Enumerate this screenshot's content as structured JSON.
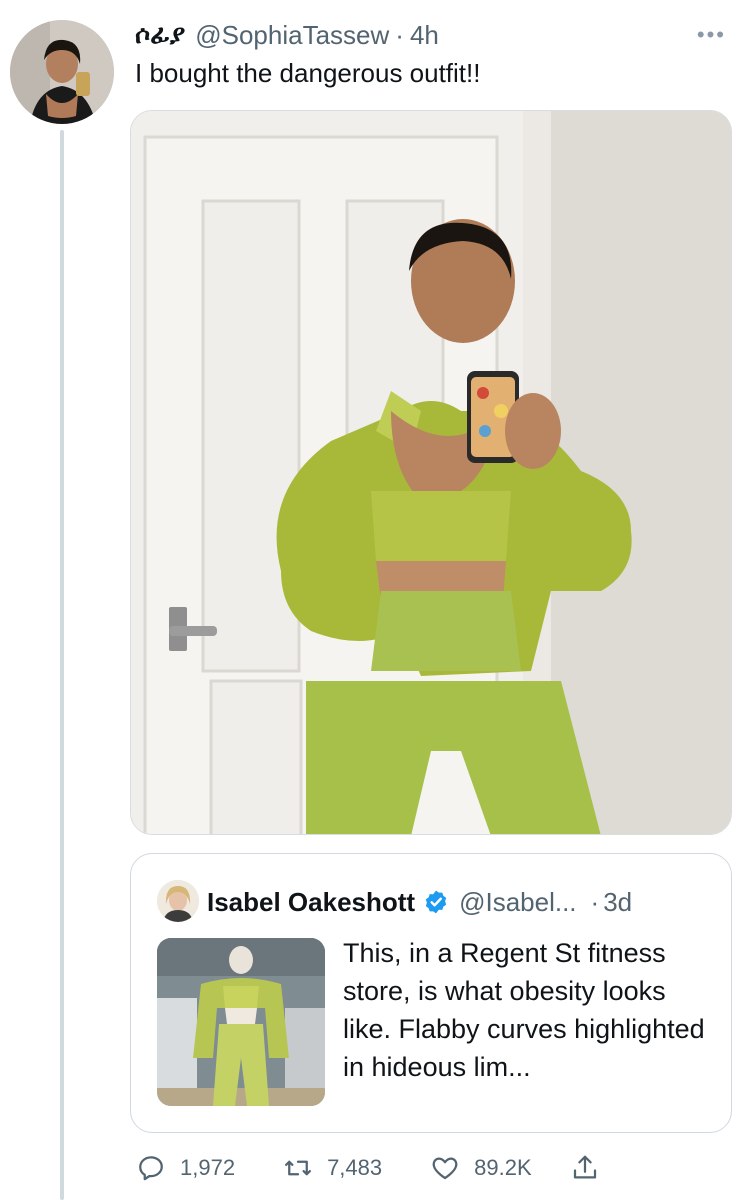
{
  "tweet": {
    "display_name": "ሶፊያ",
    "handle": "@SophiaTassew",
    "separator": "·",
    "time": "4h",
    "more_label": "•••",
    "text": "I bought the dangerous outfit!!"
  },
  "quoted_tweet": {
    "display_name": "Isabel Oakeshott",
    "handle": "@Isabel...",
    "separator": "·",
    "time": "3d",
    "text": "This, in a Regent St fitness store, is what obesity looks like. Flabby curves highlighted in hideous lim..."
  },
  "actions": {
    "replies": "1,972",
    "retweets": "7,483",
    "likes": "89.2K"
  },
  "colors": {
    "text_primary": "#0f1419",
    "text_secondary": "#536471",
    "border": "#cfd9de",
    "verified_blue": "#1d9bf0",
    "outfit_lime": "#a8b93a"
  },
  "icons": {
    "reply": "reply-icon",
    "retweet": "retweet-icon",
    "like": "heart-icon",
    "share": "share-icon",
    "verified": "verified-badge-icon",
    "more": "more-options-icon"
  }
}
